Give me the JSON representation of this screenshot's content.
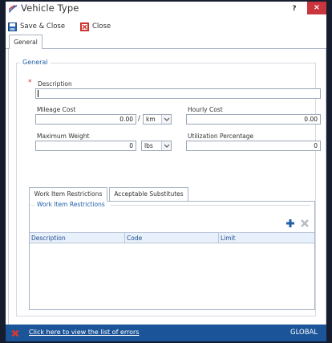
{
  "window": {
    "title": "Vehicle Type",
    "help_label": "?",
    "close_label": "×"
  },
  "toolbar": {
    "save_close_label": "Save & Close",
    "close_label": "Close"
  },
  "tabs": {
    "general_label": "General"
  },
  "general": {
    "group_label": "General",
    "required_marker": "*",
    "description": {
      "label": "Description",
      "value": ""
    },
    "mileage_cost": {
      "label": "Mileage Cost",
      "value": "0.00",
      "separator": "/",
      "unit": "km"
    },
    "hourly_cost": {
      "label": "Hourly Cost",
      "value": "0.00"
    },
    "maximum_weight": {
      "label": "Maximum Weight",
      "value": "0",
      "unit": "lbs"
    },
    "utilization_percentage": {
      "label": "Utilization Percentage",
      "value": "0"
    }
  },
  "inner_tabs": {
    "work_item_restrictions": "Work Item Restrictions",
    "acceptable_substitutes": "Acceptable Substitutes"
  },
  "restrictions": {
    "group_label": "Work Item Restrictions",
    "columns": [
      "Description",
      "Code",
      "Limit"
    ],
    "rows": []
  },
  "statusbar": {
    "errors_link": "Click here to view the list of errors",
    "region_label": "GLOBAL"
  },
  "colors": {
    "accent_blue": "#1b5499",
    "close_red": "#c9343d",
    "required_red": "#d0312d",
    "add_blue": "#1f5fa8"
  }
}
